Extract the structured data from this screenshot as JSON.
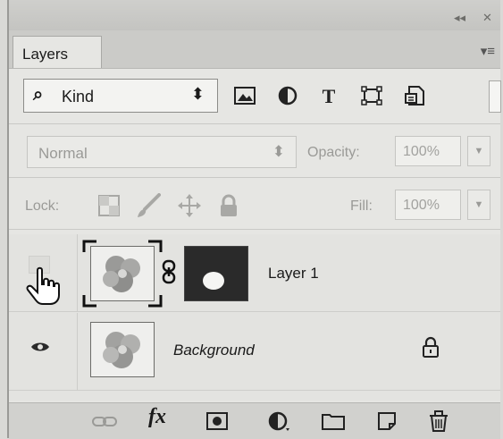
{
  "window": {
    "collapse_glyph": "◂◂",
    "close_glyph": "✕"
  },
  "tab": {
    "label": "Layers"
  },
  "panel_menu": {
    "icon": "panel-menu-icon",
    "glyph": "▾≡"
  },
  "filter": {
    "kind_label": "Kind",
    "kind_icon": "search-icon",
    "spinner_glyph": "⬍",
    "icons": [
      "pixel-layer-filter-icon",
      "adjustment-layer-filter-icon",
      "type-layer-filter-icon",
      "shape-layer-filter-icon",
      "smart-object-filter-icon"
    ]
  },
  "blend": {
    "mode": "Normal",
    "opacity_label": "Opacity:",
    "opacity_value": "100%"
  },
  "lock": {
    "label": "Lock:",
    "fill_label": "Fill:",
    "fill_value": "100%",
    "icons": [
      "lock-transparent-pixels-icon",
      "lock-image-pixels-icon",
      "lock-position-icon",
      "lock-all-icon"
    ]
  },
  "layers": [
    {
      "name": "Layer 1",
      "visible": false,
      "has_mask": true,
      "linked": true
    },
    {
      "name": "Background",
      "visible": true,
      "locked": true
    }
  ],
  "bottom_toolbar": {
    "icons": [
      "link-layers-icon",
      "layer-style-icon",
      "add-mask-icon",
      "adjustment-layer-icon",
      "new-group-icon",
      "new-layer-icon",
      "delete-layer-icon"
    ],
    "fx_label": "fx"
  },
  "colors": {
    "panel_bg": "#e6e6e3",
    "mask_fill": "#2a2a2a",
    "disabled_text": "#9a9a97"
  }
}
